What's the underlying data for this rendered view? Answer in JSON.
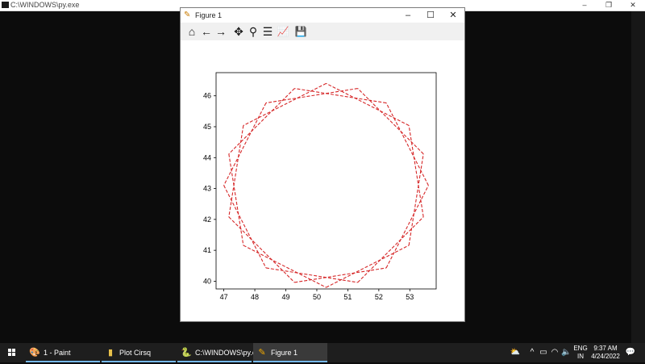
{
  "console": {
    "title": "C:\\WINDOWS\\py.exe",
    "minimize": "–",
    "restore": "❐",
    "close": "✕"
  },
  "figure_window": {
    "title": "Figure 1",
    "icon": "matplotlib-icon",
    "minimize": "–",
    "maximize": "☐",
    "close": "✕",
    "toolbar": [
      {
        "name": "home-icon",
        "glyph": "⌂"
      },
      {
        "name": "back-arrow-icon",
        "glyph": "←"
      },
      {
        "name": "forward-arrow-icon",
        "glyph": "→"
      },
      {
        "name": "pan-icon",
        "glyph": "✥"
      },
      {
        "name": "zoom-icon",
        "glyph": "⚲"
      },
      {
        "name": "configure-subplots-icon",
        "glyph": "☰"
      },
      {
        "name": "edit-axes-icon",
        "glyph": "📈"
      },
      {
        "name": "save-icon",
        "glyph": "💾"
      }
    ]
  },
  "chart_data": {
    "type": "line",
    "title": "",
    "xlabel": "",
    "ylabel": "",
    "xlim": [
      46.75,
      53.85
    ],
    "ylim": [
      39.75,
      46.75
    ],
    "xticks": [
      47,
      48,
      49,
      50,
      51,
      52,
      53
    ],
    "yticks": [
      40,
      41,
      42,
      43,
      44,
      45,
      46
    ],
    "grid": false,
    "series": [
      {
        "style": "dashed",
        "color": "#d62728",
        "center": [
          50.3,
          43.1
        ],
        "outer_radius": 3.3,
        "inner_radius": 2.3,
        "points": 20,
        "rotation_deg": 0
      }
    ]
  },
  "taskbar": {
    "items": [
      {
        "label": "1 - Paint",
        "icon": "paint-icon"
      },
      {
        "label": "Plot Cirsq",
        "icon": "folder-icon"
      },
      {
        "label": "C:\\WINDOWS\\py.exe",
        "icon": "python-icon"
      },
      {
        "label": "Figure 1",
        "icon": "matplotlib-icon"
      }
    ],
    "tray": {
      "language_top": "ENG",
      "language_bottom": "IN",
      "time": "9:37 AM",
      "date": "4/24/2022"
    }
  }
}
